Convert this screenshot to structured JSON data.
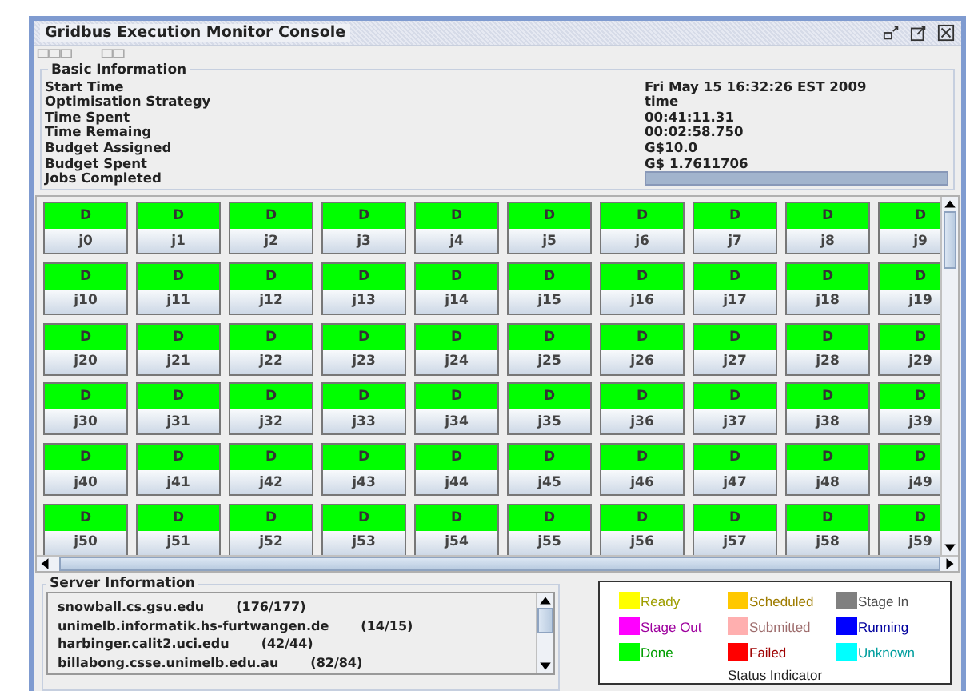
{
  "window": {
    "title": "Gridbus Execution Monitor Console"
  },
  "basic_information": {
    "title": "Basic Information",
    "rows": [
      {
        "label": "Start Time",
        "value": "Fri May 15 16:32:26 EST 2009"
      },
      {
        "label": "Optimisation Strategy",
        "value": "time"
      },
      {
        "label": "Time Spent",
        "value": "00:41:11.31"
      },
      {
        "label": "Time Remaing",
        "value": "00:02:58.750"
      },
      {
        "label": "Budget Assigned",
        "value": "G$10.0"
      },
      {
        "label": "Budget Spent",
        "value": "G$ 1.7611706"
      },
      {
        "label": "Jobs Completed",
        "level": 1
      }
    ]
  },
  "jobs": [
    {
      "status": "D",
      "name": "j0"
    },
    {
      "status": "D",
      "name": "j1"
    },
    {
      "status": "D",
      "name": "j2"
    },
    {
      "status": "D",
      "name": "j3"
    },
    {
      "status": "D",
      "name": "j4"
    },
    {
      "status": "D",
      "name": "j5"
    },
    {
      "status": "D",
      "name": "j6"
    },
    {
      "status": "D",
      "name": "j7"
    },
    {
      "status": "D",
      "name": "j8"
    },
    {
      "status": "D",
      "name": "j9"
    },
    {
      "status": "D",
      "name": "j10"
    },
    {
      "status": "D",
      "name": "j11"
    },
    {
      "status": "D",
      "name": "j12"
    },
    {
      "status": "D",
      "name": "j13"
    },
    {
      "status": "D",
      "name": "j14"
    },
    {
      "status": "D",
      "name": "j15"
    },
    {
      "status": "D",
      "name": "j16"
    },
    {
      "status": "D",
      "name": "j17"
    },
    {
      "status": "D",
      "name": "j18"
    },
    {
      "status": "D",
      "name": "j19"
    },
    {
      "status": "D",
      "name": "j20"
    },
    {
      "status": "D",
      "name": "j21"
    },
    {
      "status": "D",
      "name": "j22"
    },
    {
      "status": "D",
      "name": "j23"
    },
    {
      "status": "D",
      "name": "j24"
    },
    {
      "status": "D",
      "name": "j25"
    },
    {
      "status": "D",
      "name": "j26"
    },
    {
      "status": "D",
      "name": "j27"
    },
    {
      "status": "D",
      "name": "j28"
    },
    {
      "status": "D",
      "name": "j29"
    },
    {
      "status": "D",
      "name": "j30"
    },
    {
      "status": "D",
      "name": "j31"
    },
    {
      "status": "D",
      "name": "j32"
    },
    {
      "status": "D",
      "name": "j33"
    },
    {
      "status": "D",
      "name": "j34"
    },
    {
      "status": "D",
      "name": "j35"
    },
    {
      "status": "D",
      "name": "j36"
    },
    {
      "status": "D",
      "name": "j37"
    },
    {
      "status": "D",
      "name": "j38"
    },
    {
      "status": "D",
      "name": "j39"
    },
    {
      "status": "D",
      "name": "j40"
    },
    {
      "status": "D",
      "name": "j41"
    },
    {
      "status": "D",
      "name": "j42"
    },
    {
      "status": "D",
      "name": "j43"
    },
    {
      "status": "D",
      "name": "j44"
    },
    {
      "status": "D",
      "name": "j45"
    },
    {
      "status": "D",
      "name": "j46"
    },
    {
      "status": "D",
      "name": "j47"
    },
    {
      "status": "D",
      "name": "j48"
    },
    {
      "status": "D",
      "name": "j49"
    },
    {
      "status": "D",
      "name": "j50"
    },
    {
      "status": "D",
      "name": "j51"
    },
    {
      "status": "D",
      "name": "j52"
    },
    {
      "status": "D",
      "name": "j53"
    },
    {
      "status": "D",
      "name": "j54"
    },
    {
      "status": "D",
      "name": "j55"
    },
    {
      "status": "D",
      "name": "j56"
    },
    {
      "status": "D",
      "name": "j57"
    },
    {
      "status": "D",
      "name": "j58"
    },
    {
      "status": "D",
      "name": "j59"
    }
  ],
  "server_information": {
    "title": "Server Information",
    "servers": [
      {
        "host": "snowball.cs.gsu.edu",
        "count": "(176/177)"
      },
      {
        "host": "unimelb.informatik.hs-furtwangen.de",
        "count": "(14/15)"
      },
      {
        "host": "harbinger.calit2.uci.edu",
        "count": "(42/44)"
      },
      {
        "host": "billabong.csse.unimelb.edu.au",
        "count": "(82/84)"
      }
    ]
  },
  "status_indicator": {
    "title": "Status Indicator",
    "items": [
      {
        "label": "Ready",
        "color": "#ffff00"
      },
      {
        "label": "Scheduled",
        "color": "#ffc800"
      },
      {
        "label": "Stage In",
        "color": "#808080"
      },
      {
        "label": "Stage Out",
        "color": "#ff00ff"
      },
      {
        "label": "Submitted",
        "color": "#ffafaf"
      },
      {
        "label": "Running",
        "color": "#0000ff"
      },
      {
        "label": "Done",
        "color": "#00ff00"
      },
      {
        "label": "Failed",
        "color": "#ff0000"
      },
      {
        "label": "Unknown",
        "color": "#00ffff"
      }
    ]
  }
}
